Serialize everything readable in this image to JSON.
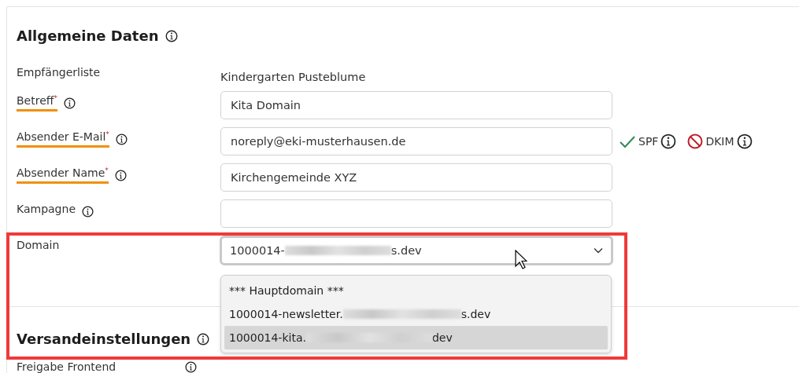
{
  "section_general": {
    "title": "Allgemeine Daten",
    "recipient_list": {
      "label": "Empfängerliste",
      "value": "Kindergarten Pusteblume"
    },
    "fields": [
      {
        "label": "Betreff",
        "required_mark": "*",
        "value": "Kita Domain"
      },
      {
        "label": "Absender E-Mail",
        "required_mark": "*",
        "value": "noreply@eki-musterhausen.de",
        "checks": [
          {
            "label": "SPF",
            "kind": "ok"
          },
          {
            "label": "DKIM",
            "kind": "fail"
          }
        ]
      },
      {
        "label": "Absender Name",
        "required_mark": "*",
        "value": "Kirchengemeinde XYZ"
      },
      {
        "label": "Kampagne"
      }
    ],
    "domain": {
      "label": "Domain",
      "value_start": "1000014-",
      "value_end": "s.dev",
      "options": [
        {
          "text_start": "*** Hauptdomain ***",
          "selected": false
        },
        {
          "text_start": "1000014-newsletter.",
          "text_end": "s.dev",
          "selected": false
        },
        {
          "text_start": "1000014-kita.",
          "text_end": "dev",
          "selected": true
        }
      ]
    }
  },
  "section_shipping": {
    "title": "Versandeinstellungen",
    "rows": [
      {
        "label": "Freigabe Frontend"
      }
    ]
  },
  "highlight": {
    "color": "#f03a3a"
  }
}
